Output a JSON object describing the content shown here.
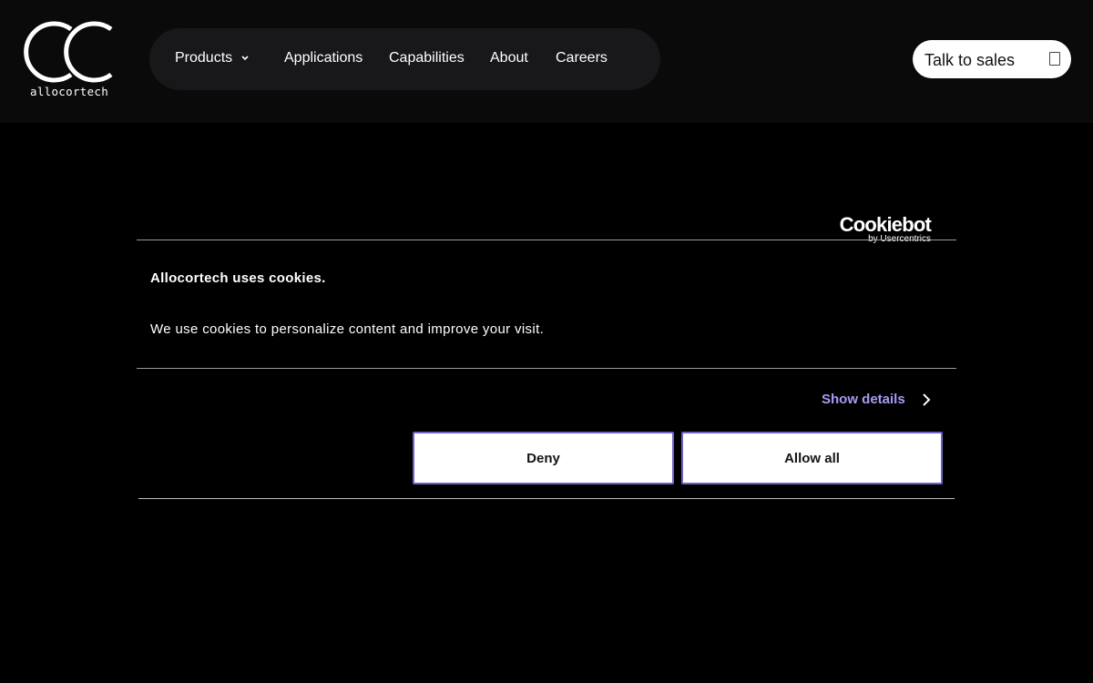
{
  "brand": {
    "logo_text": "allocortech"
  },
  "nav": {
    "items": [
      {
        "label": "Products"
      },
      {
        "label": "Applications"
      },
      {
        "label": "Capabilities"
      },
      {
        "label": "About"
      },
      {
        "label": "Careers"
      }
    ]
  },
  "header": {
    "cta_label": "Talk to sales"
  },
  "cookie_dialog": {
    "provider_name": "Cookiebot",
    "provider_sub": "by Usercentrics",
    "title": "Allocortech uses cookies.",
    "body": "We use cookies to personalize content and improve your visit.",
    "show_details_label": "Show details",
    "deny_label": "Deny",
    "allow_label": "Allow all"
  },
  "colors": {
    "background": "#000000",
    "header_bg": "#0a0a0b",
    "nav_pill": "#18181a",
    "link_accent": "#a49df5",
    "button_border": "#6e64c8"
  }
}
